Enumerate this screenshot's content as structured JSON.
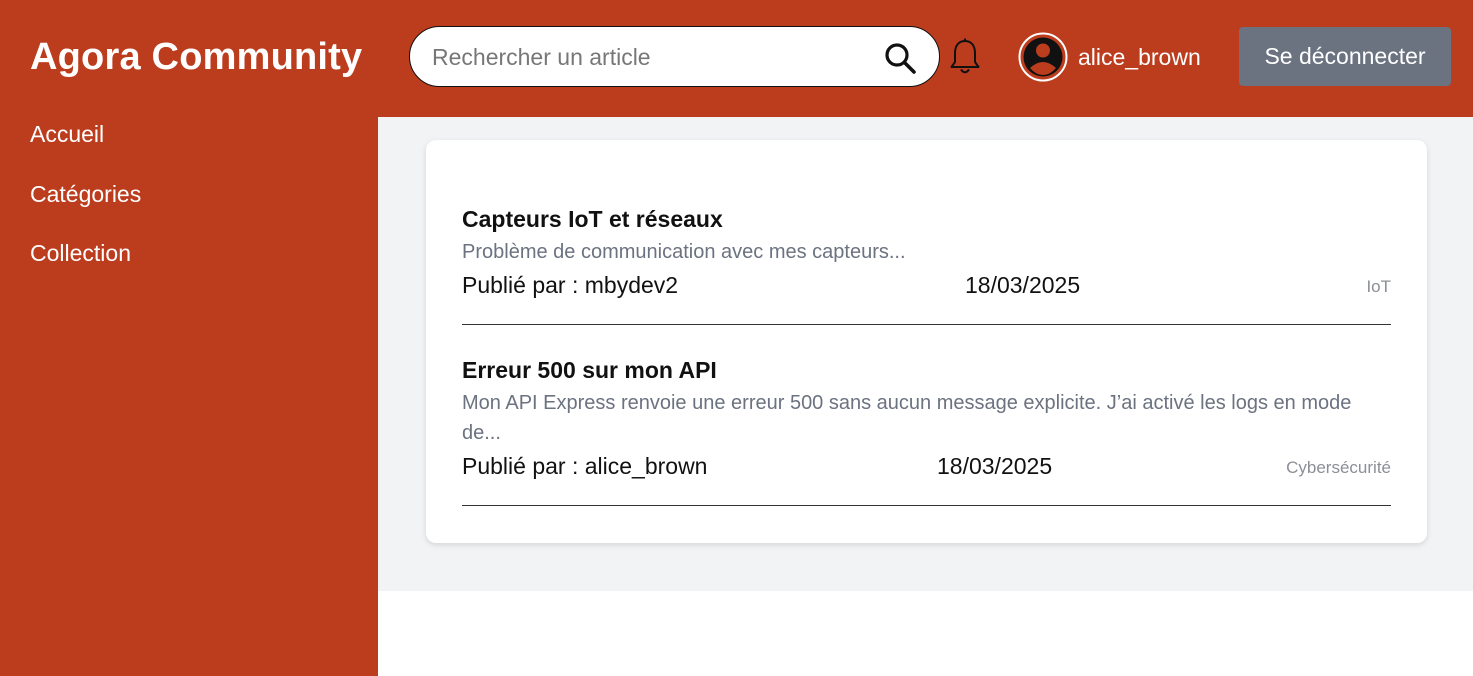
{
  "app": {
    "title": "Agora Community",
    "accent_color": "#bc3c1e",
    "logout_button_color": "#6b7280"
  },
  "header": {
    "search": {
      "placeholder": "Rechercher un article",
      "value": ""
    },
    "search_icon": "search-icon",
    "notification_icon": "bell-icon",
    "avatar_icon": "user-circle-icon",
    "username": "alice_brown",
    "logout_label": "Se déconnecter"
  },
  "sidebar": {
    "items": [
      {
        "label": "Accueil"
      },
      {
        "label": "Catégories"
      },
      {
        "label": "Collection"
      }
    ]
  },
  "articles": [
    {
      "title": "Capteurs IoT et réseaux",
      "excerpt": "Problème de communication avec mes capteurs...",
      "author": "Publié par : mbydev2",
      "date": "18/03/2025",
      "category": "IoT"
    },
    {
      "title": "Erreur 500 sur mon API",
      "excerpt": "Mon API Express renvoie une erreur 500 sans aucun message explicite. J’ai activé les logs en mode de...",
      "author": "Publié par : alice_brown",
      "date": "18/03/2025",
      "category": "Cybersécurité"
    }
  ]
}
